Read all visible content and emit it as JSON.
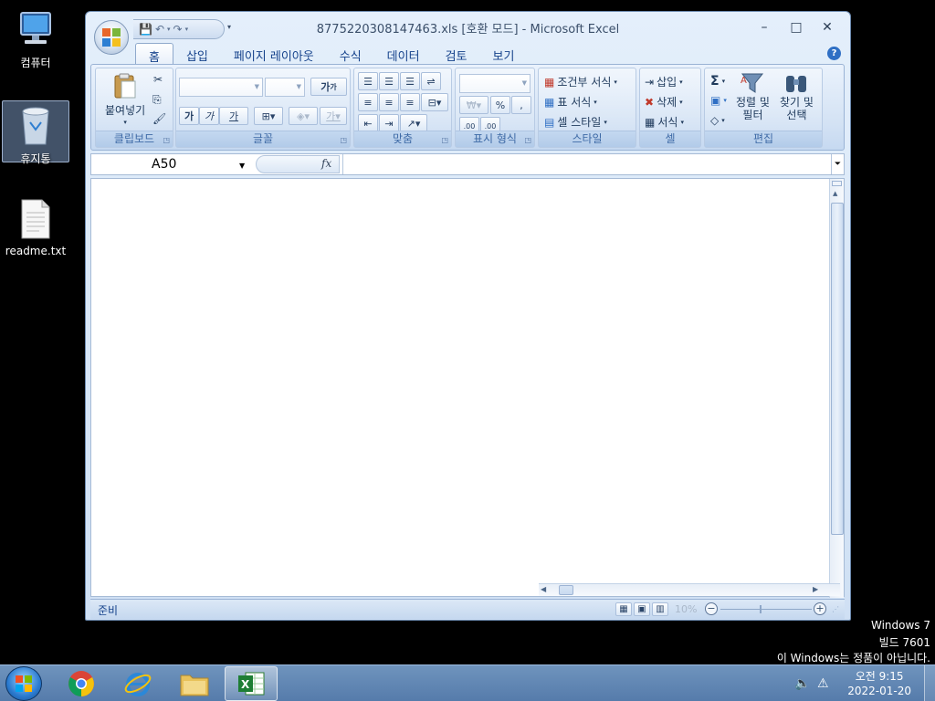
{
  "desktop": {
    "icons": [
      {
        "label": "컴퓨터"
      },
      {
        "label": "휴지통"
      },
      {
        "label": "readme.txt"
      }
    ],
    "watermark": {
      "line1": "Windows 7",
      "line2": "빌드 7601",
      "line3": "이 Windows는 정품이 아닙니다."
    }
  },
  "window": {
    "title": "8775220308147463.xls  [호환 모드] - Microsoft Excel",
    "controls": {
      "minimize": "–",
      "maximize": "□",
      "close": "✕"
    }
  },
  "ribbon": {
    "tabs": [
      {
        "label": "홈",
        "active": true
      },
      {
        "label": "삽입"
      },
      {
        "label": "페이지 레이아웃"
      },
      {
        "label": "수식"
      },
      {
        "label": "데이터"
      },
      {
        "label": "검토"
      },
      {
        "label": "보기"
      }
    ],
    "groups": {
      "clipboard": {
        "label": "클립보드",
        "paste": "붙여넣기"
      },
      "font": {
        "label": "글꼴",
        "bold": "가",
        "italic": "가",
        "underline": "가",
        "grow": "가",
        "shrink": "가"
      },
      "alignment": {
        "label": "맞춤"
      },
      "number": {
        "label": "표시 형식",
        "currency": "₩",
        "percent": "%",
        "comma": ",",
        "inc_decimal": ".00",
        "dec_decimal": ".00"
      },
      "styles": {
        "label": "스타일",
        "conditional": "조건부 서식",
        "table": "표 서식",
        "cell": "셀 스타일"
      },
      "cells": {
        "label": "셀",
        "insert": "삽입",
        "delete": "삭제",
        "format": "서식"
      },
      "editing": {
        "label": "편집",
        "sum": "Σ",
        "sort_line1": "정렬 및",
        "sort_line2": "필터",
        "find_line1": "찾기 및",
        "find_line2": "선택"
      }
    }
  },
  "formula_bar": {
    "name_box": "A50",
    "fx": "fx",
    "value": ""
  },
  "status_bar": {
    "status": "준비",
    "zoom": "10%"
  },
  "taskbar": {
    "clock_time": "오전 9:15",
    "clock_date": "2022-01-20"
  }
}
